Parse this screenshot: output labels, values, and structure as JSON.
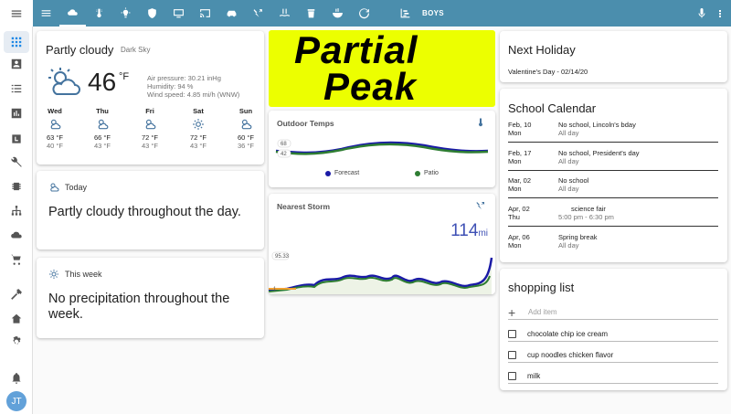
{
  "header": {
    "tab_label": "BOYS"
  },
  "sidebar": {
    "avatar_initials": "JT"
  },
  "weather": {
    "title": "Partly cloudy",
    "source": "Dark Sky",
    "temperature": "46",
    "unit": "°F",
    "attributes": {
      "pressure": "Air pressure: 30.21 inHg",
      "humidity": "Humidity: 94 %",
      "wind": "Wind speed: 4.85 mi/h (WNW)"
    },
    "forecast": [
      {
        "day": "Wed",
        "high": "63 °F",
        "low": "40 °F",
        "icon": "partly-cloudy-icon"
      },
      {
        "day": "Thu",
        "high": "66 °F",
        "low": "43 °F",
        "icon": "partly-cloudy-icon"
      },
      {
        "day": "Fri",
        "high": "72 °F",
        "low": "43 °F",
        "icon": "partly-cloudy-icon"
      },
      {
        "day": "Sat",
        "high": "72 °F",
        "low": "43 °F",
        "icon": "sunny-icon"
      },
      {
        "day": "Sun",
        "high": "60 °F",
        "low": "36 °F",
        "icon": "partly-cloudy-icon"
      }
    ]
  },
  "today": {
    "heading": "Today",
    "text": "Partly cloudy throughout the day."
  },
  "this_week": {
    "heading": "This week",
    "text": "No precipitation throughout the week."
  },
  "banner": {
    "line1": "Partial",
    "line2": "Peak"
  },
  "outdoor_temps": {
    "title": "Outdoor Temps",
    "max_label": "68",
    "min_label": "42",
    "legend": [
      "Forecast",
      "Patio"
    ]
  },
  "nearest_storm": {
    "title": "Nearest Storm",
    "value": "114",
    "unit": "mi",
    "max_label": "95.33",
    "min_label": "1"
  },
  "holiday": {
    "title": "Next Holiday",
    "text": "Valentine's Day - 02/14/20"
  },
  "calendar": {
    "title": "School Calendar",
    "events": [
      {
        "date": "Feb, 10",
        "weekday": "Mon",
        "title": "No school, Lincoln's bday",
        "time": "All day"
      },
      {
        "date": "Feb, 17",
        "weekday": "Mon",
        "title": "No school, President's day",
        "time": "All day"
      },
      {
        "date": "Mar, 02",
        "weekday": "Mon",
        "title": "No school",
        "time": "All day"
      },
      {
        "date": "Apr, 02",
        "weekday": "Thu",
        "title": "science fair",
        "time": "5:00 pm - 6:30 pm"
      },
      {
        "date": "Apr, 06",
        "weekday": "Mon",
        "title": "Spring break",
        "time": "All day"
      }
    ]
  },
  "shopping": {
    "title": "shopping list",
    "add_placeholder": "Add item",
    "items": [
      "chocolate chip ice cream",
      "cup noodles chicken flavor",
      "milk"
    ]
  },
  "colors": {
    "header": "#4b8ead",
    "forecast_series": "#1a1aa6",
    "patio_series": "#2e7d32",
    "storm_value": "#3f51b5",
    "banner": "#ecff00"
  }
}
